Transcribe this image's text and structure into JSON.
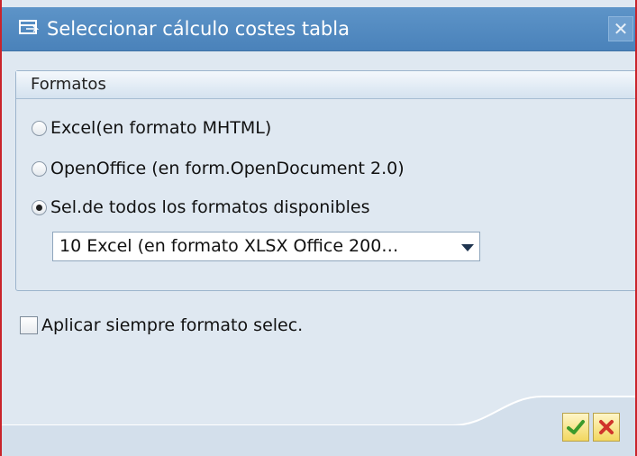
{
  "dialog": {
    "title": "Seleccionar cálculo costes tabla",
    "close_icon": "close-icon",
    "colors": {
      "titlebar": "#5d94c8",
      "frame_border": "#c9242b",
      "body": "#dfe8f1"
    }
  },
  "formats_group": {
    "title": "Formatos",
    "options": [
      {
        "label": "Excel(en formato MHTML)",
        "selected": false
      },
      {
        "label": "OpenOffice (en form.OpenDocument 2.0)",
        "selected": false
      },
      {
        "label": "Sel.de todos los formatos disponibles",
        "selected": true
      }
    ],
    "format_select": {
      "value": "10 Excel (en formato XLSX Office 200…",
      "icon": "chevron-down-icon"
    }
  },
  "always_apply": {
    "label": "Aplicar siempre formato selec.",
    "checked": false
  },
  "buttons": {
    "ok_icon": "checkmark-icon",
    "cancel_icon": "cancel-x-icon"
  }
}
